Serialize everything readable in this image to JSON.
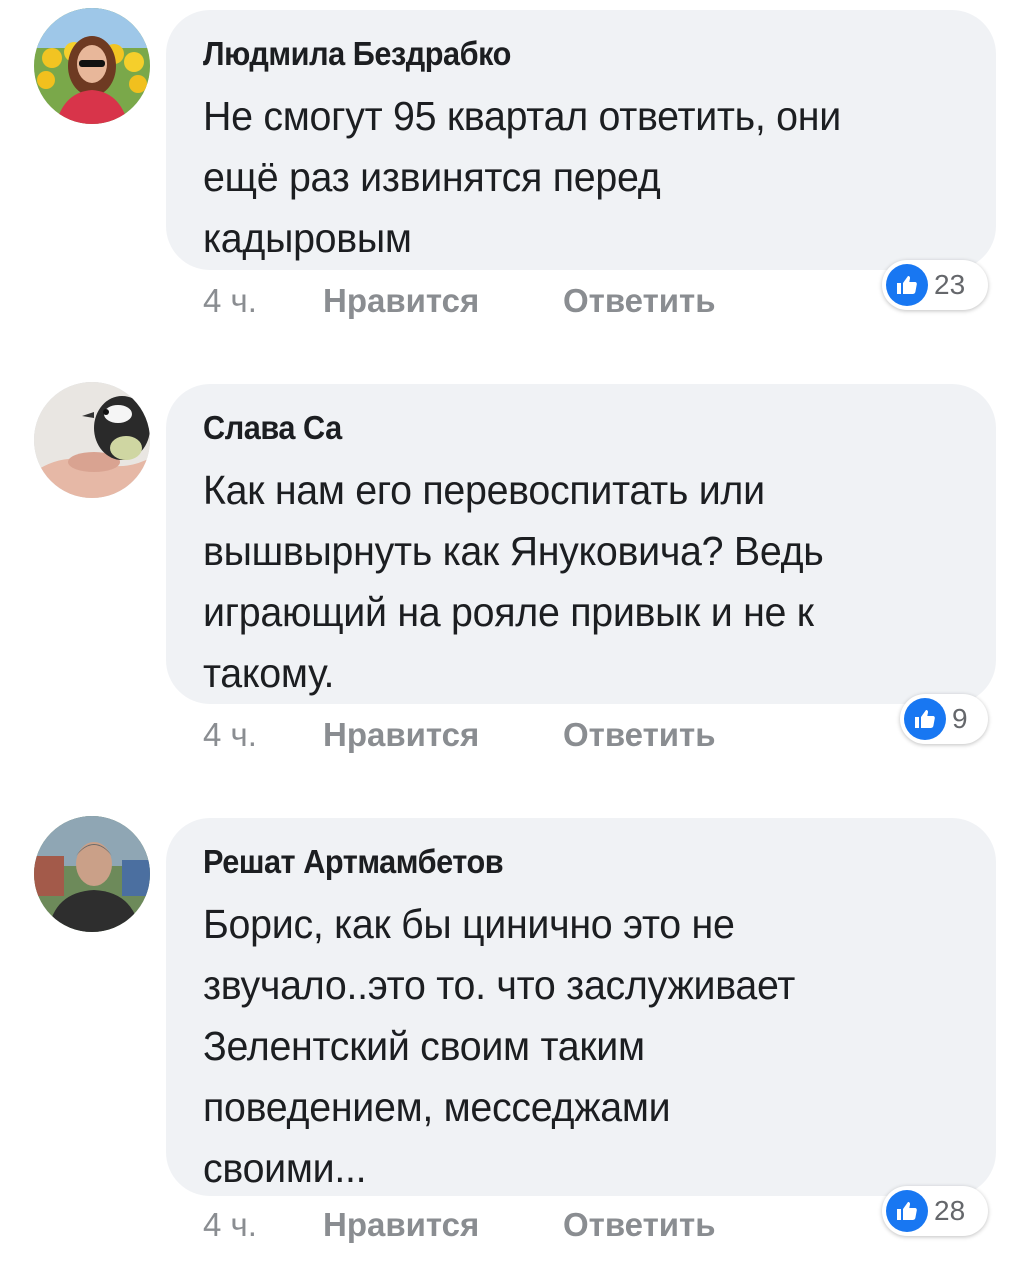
{
  "comments": [
    {
      "author": "Людмила Бездрабко",
      "lines": [
        "Не смогут 95 квартал ответить, они",
        "ещё раз извинятся перед",
        "кадыровым"
      ],
      "time": "4 ч.",
      "like_label": "Нравится",
      "reply_label": "Ответить",
      "reaction_icon": "like-icon",
      "reaction_count": "23"
    },
    {
      "author": "Слава Са",
      "lines": [
        "Как нам его перевоспитать или",
        "вышвырнуть как Януковича? Ведь",
        "играющий на рояле привык и не к",
        "такому."
      ],
      "time": "4 ч.",
      "like_label": "Нравится",
      "reply_label": "Ответить",
      "reaction_icon": "like-icon",
      "reaction_count": "9"
    },
    {
      "author": "Решат Артмамбетов",
      "lines": [
        "Борис, как бы цинично это не",
        "звучало..это то. что заслуживает",
        "Зелентский своим таким",
        "поведением, месседжами",
        "своими..."
      ],
      "time": "4 ч.",
      "like_label": "Нравится",
      "reply_label": "Ответить",
      "reaction_icon": "like-icon",
      "reaction_count": "28"
    }
  ],
  "colors": {
    "bubble": "#f0f2f5",
    "text": "#1c1e21",
    "meta": "#8a8d91",
    "like_blue": "#1877f2"
  }
}
